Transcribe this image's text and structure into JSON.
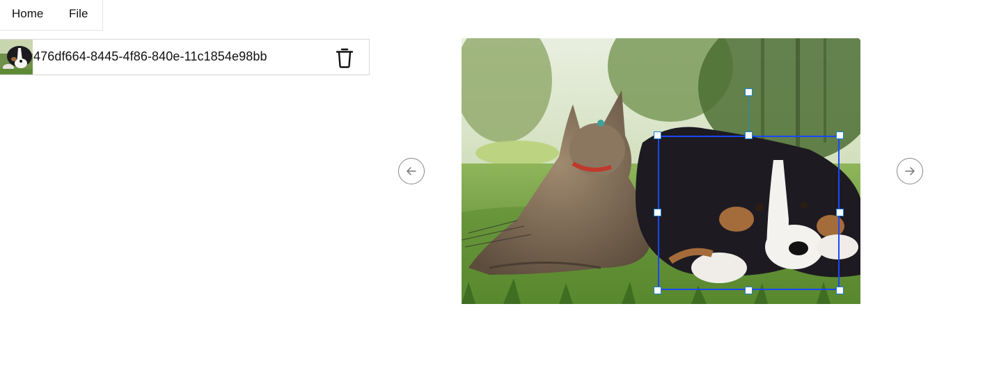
{
  "nav": {
    "home_label": "Home",
    "file_label": "File"
  },
  "file_list": {
    "items": [
      {
        "name": "476df664-8445-4f86-840e-11c1854e98bb",
        "thumbnail_icon": "dog-thumbnail",
        "delete_icon": "trash-icon"
      }
    ]
  },
  "viewer": {
    "prev_icon": "arrow-left-icon",
    "next_icon": "arrow-right-icon",
    "image_subject": "cat-and-puppy-photo",
    "selection_color": "#1a47ff",
    "handle_color": "#1a7fd0"
  }
}
